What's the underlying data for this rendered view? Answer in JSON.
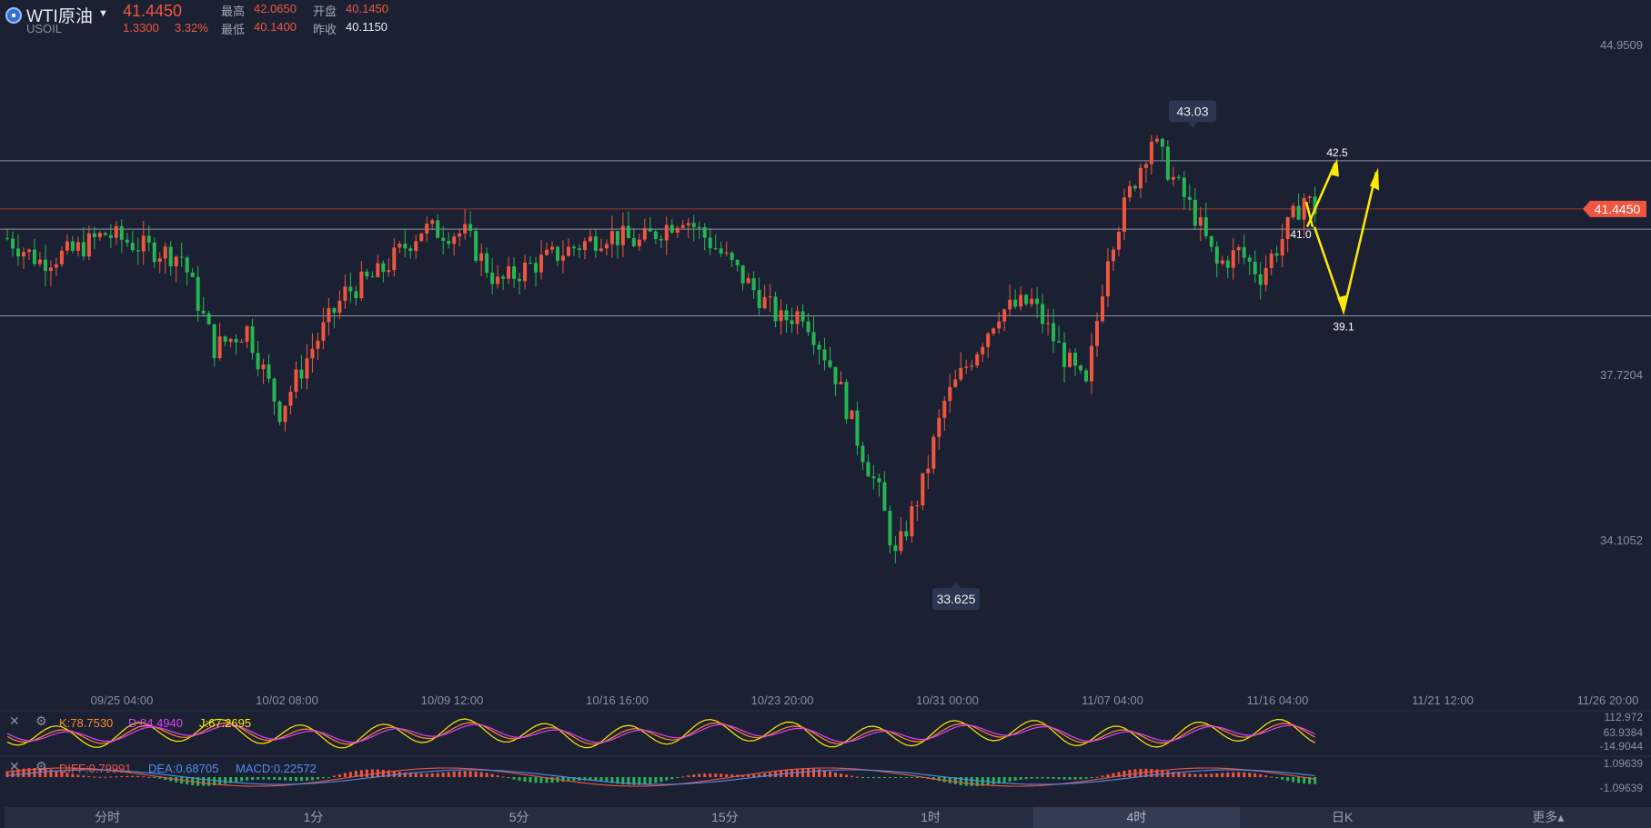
{
  "header": {
    "symbol": "WTI原油",
    "code": "USOIL",
    "price": "41.4450",
    "change": "1.3300",
    "change_pct": "3.32%",
    "high_label": "最高",
    "high": "42.0650",
    "open_label": "开盘",
    "open": "40.1450",
    "low_label": "最低",
    "low": "40.1400",
    "prev_label": "昨收",
    "prev": "40.1150"
  },
  "colors": {
    "up": "#f0553f",
    "down": "#26b552",
    "background": "#1b2133",
    "annotation": "#ffea00"
  },
  "chart_data": {
    "type": "candlestick",
    "timeframe": "4时",
    "y_ticks": [
      "44.9509",
      "37.7204",
      "34.1052"
    ],
    "x_ticks": [
      "09/25 04:00",
      "10/02 08:00",
      "10/09 12:00",
      "10/16 16:00",
      "10/23 20:00",
      "10/31 00:00",
      "11/07 04:00",
      "11/16 04:00",
      "11/21 12:00",
      "11/26 20:00"
    ],
    "last_price": 41.445,
    "last_price_label": "41.4450",
    "high_marker": {
      "value": 43.03,
      "label": "43.03"
    },
    "low_marker": {
      "value": 33.625,
      "label": "33.625"
    },
    "horizontal_lines": [
      42.5,
      41.0,
      39.1
    ],
    "annotations": [
      {
        "label": "42.5",
        "value": 42.5
      },
      {
        "label": "41.0",
        "value": 41.0
      },
      {
        "label": "39.1",
        "value": 39.1
      }
    ],
    "anchors": [
      [
        0,
        40.8
      ],
      [
        6,
        40.3
      ],
      [
        12,
        40.5
      ],
      [
        18,
        40.9
      ],
      [
        25,
        40.6
      ],
      [
        32,
        40.4
      ],
      [
        38,
        38.4
      ],
      [
        44,
        38.8
      ],
      [
        50,
        37.0
      ],
      [
        56,
        38.4
      ],
      [
        62,
        39.6
      ],
      [
        68,
        40.0
      ],
      [
        76,
        41.0
      ],
      [
        84,
        40.9
      ],
      [
        90,
        39.8
      ],
      [
        96,
        40.2
      ],
      [
        104,
        40.6
      ],
      [
        110,
        40.9
      ],
      [
        116,
        40.7
      ],
      [
        124,
        41.3
      ],
      [
        130,
        40.6
      ],
      [
        136,
        39.8
      ],
      [
        142,
        39.0
      ],
      [
        146,
        39.2
      ],
      [
        152,
        37.8
      ],
      [
        156,
        36.4
      ],
      [
        160,
        35.2
      ],
      [
        163,
        33.8
      ],
      [
        168,
        35.4
      ],
      [
        172,
        37.2
      ],
      [
        176,
        38.0
      ],
      [
        182,
        39.2
      ],
      [
        188,
        39.4
      ],
      [
        194,
        38.2
      ],
      [
        198,
        37.5
      ],
      [
        202,
        40.5
      ],
      [
        206,
        41.8
      ],
      [
        210,
        43.0
      ],
      [
        214,
        42.1
      ],
      [
        218,
        41.3
      ],
      [
        222,
        40.2
      ],
      [
        226,
        40.5
      ],
      [
        230,
        40.0
      ],
      [
        234,
        40.8
      ],
      [
        238,
        41.7
      ],
      [
        240,
        41.45
      ]
    ],
    "kdj": {
      "labels": [
        "K:78.7530",
        "D:84.4940",
        "J:67.2695"
      ],
      "axis": [
        "112.972",
        "63.9384",
        "-14.9044"
      ]
    },
    "macd": {
      "labels": [
        "DIFF:0.79991",
        "DEA:0.68705",
        "MACD:0.22572"
      ],
      "axis": [
        "1.09639",
        "-1.09639"
      ]
    }
  },
  "tabs": [
    "分时",
    "1分",
    "5分",
    "15分",
    "1时",
    "4时",
    "日K",
    "更多▴"
  ],
  "active_tab": "4时"
}
